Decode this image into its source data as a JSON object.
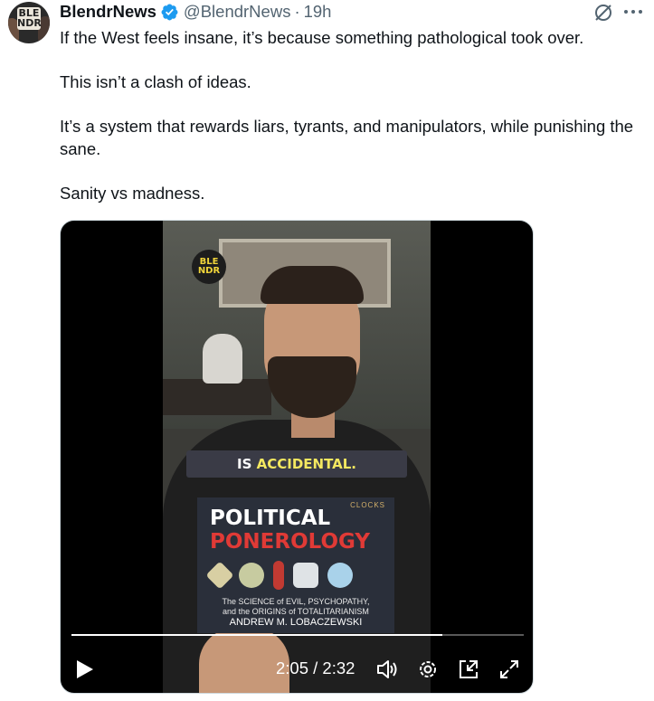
{
  "tweet": {
    "author_name": "BlendrNews",
    "handle": "@BlendrNews",
    "separator": "·",
    "time": "19h",
    "avatar_logo": "BLE NDR",
    "paragraphs": [
      "If the West feels insane, it’s because something pathological took over.",
      "This isn’t a clash of ideas.",
      "It’s a system that rewards liars, tyrants, and manipulators, while punishing the sane.",
      "Sanity vs madness."
    ]
  },
  "video": {
    "watermark": "BLE NDR",
    "caption_prefix": "IS",
    "caption_highlight": "ACCIDENTAL.",
    "book": {
      "title_line1": "POLITICAL",
      "title_line2": "PONEROLOGY",
      "publisher_mark": "CLOCKS",
      "subtitle_line1": "The SCIENCE of EVIL, PSYCHOPATHY,",
      "subtitle_line2": "and the ORIGINS of TOTALITARIANISM",
      "author": "ANDREW M. LOBACZEWSKI"
    },
    "time_display": "2:05 / 2:32",
    "progress_fraction": 0.82
  },
  "icons": {
    "verified": "verified-badge-icon",
    "grok": "grok-icon",
    "more": "more-icon",
    "play": "play-icon",
    "volume": "volume-icon",
    "settings": "settings-icon",
    "pip": "picture-in-picture-icon",
    "fullscreen": "fullscreen-icon"
  },
  "colors": {
    "verified_blue": "#1d9bf0",
    "text_primary": "#0f1419",
    "text_secondary": "#536471",
    "caption_highlight": "#f4e860",
    "book_red": "#e03a36"
  }
}
